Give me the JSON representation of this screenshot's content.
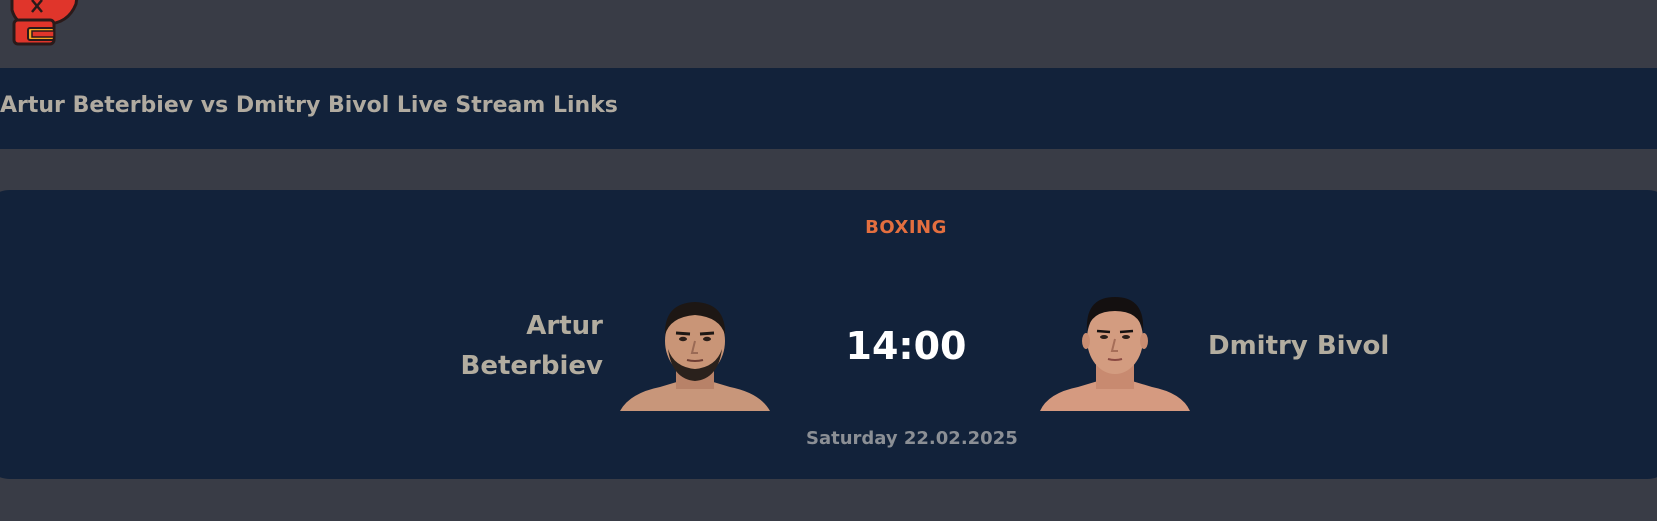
{
  "header": {
    "logo_icon": "boxing-glove-icon",
    "title": "Artur Beterbiev vs Dmitry Bivol Live Stream Links"
  },
  "event": {
    "sport": "BOXING",
    "time": "14:00",
    "date": "Saturday 22.02.2025",
    "fighter_left": {
      "first_name": "Artur",
      "last_name": "Beterbiev",
      "portrait_icon": "fighter-portrait-icon"
    },
    "fighter_right": {
      "name": "Dmitry Bivol",
      "portrait_icon": "fighter-portrait-icon"
    }
  },
  "colors": {
    "page_background": "#393c46",
    "panel_background": "#12223a",
    "sport_accent": "#e46f3f",
    "name_text": "#b3ad9f",
    "time_text": "#ffffff",
    "date_text": "#8b8f95",
    "logo_red": "#e0352b"
  }
}
